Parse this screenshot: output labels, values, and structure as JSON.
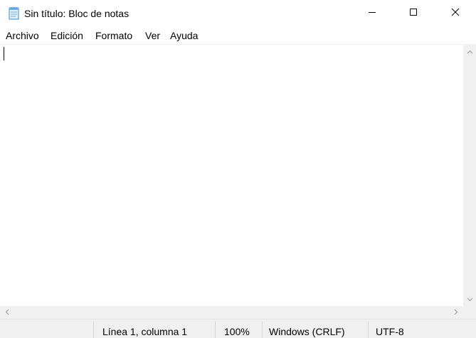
{
  "window": {
    "title": "Sin título: Bloc de notas",
    "app_icon": "notepad-icon",
    "controls": {
      "minimize_icon": "minimize-icon",
      "maximize_icon": "maximize-icon",
      "close_icon": "close-icon"
    }
  },
  "menu": {
    "items": [
      {
        "label": "Archivo"
      },
      {
        "label": "Edición"
      },
      {
        "label": "Formato"
      },
      {
        "label": "Ver"
      },
      {
        "label": "Ayuda"
      }
    ]
  },
  "editor": {
    "content": ""
  },
  "statusbar": {
    "position": "Línea 1, columna 1",
    "zoom": "100%",
    "line_endings": "Windows (CRLF)",
    "encoding": "UTF-8"
  },
  "colors": {
    "chrome": "#f0f0f0",
    "background": "#ffffff",
    "arrow": "#a0a0a0"
  }
}
